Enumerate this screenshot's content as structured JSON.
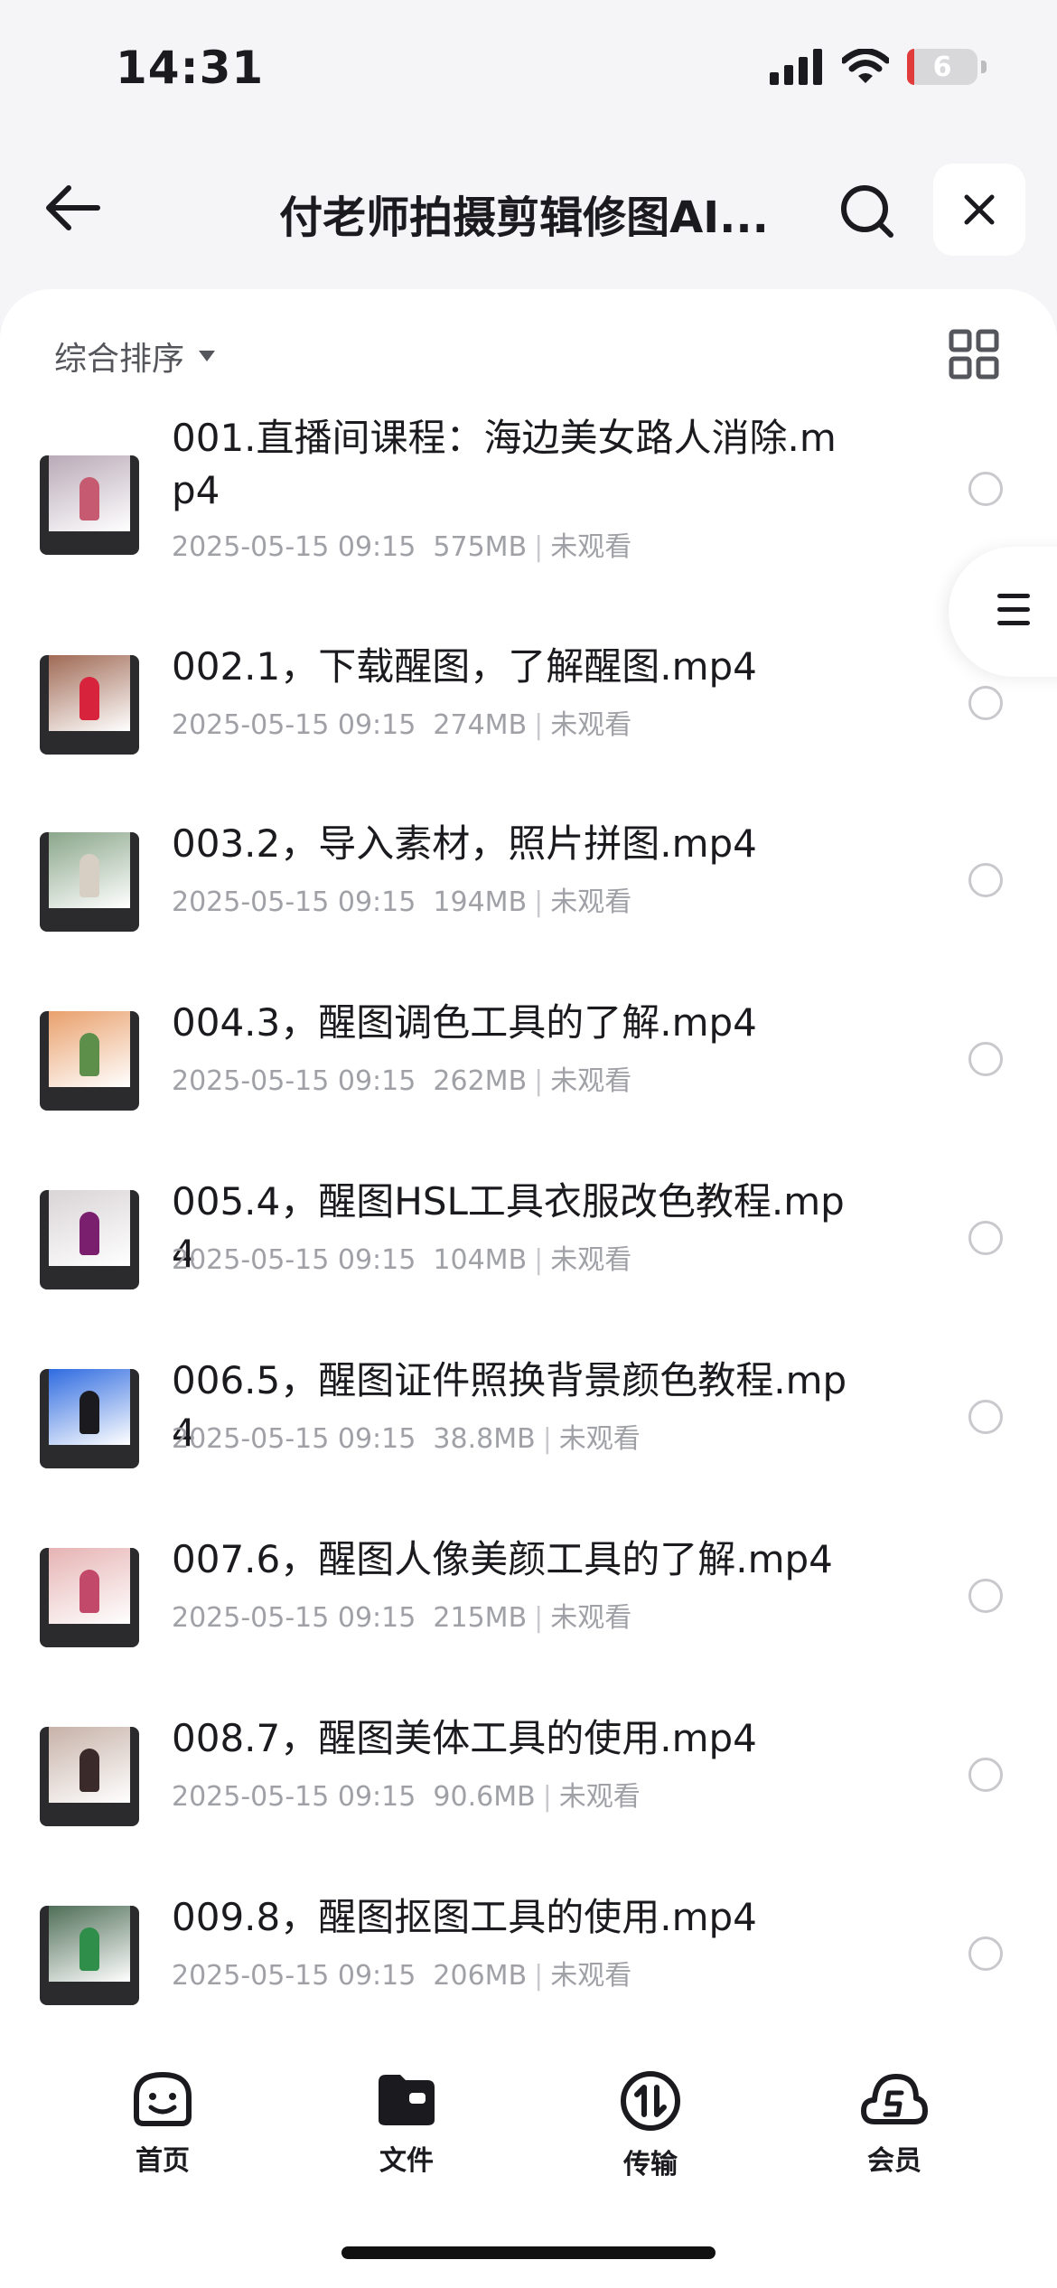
{
  "status_bar": {
    "time": "14:31",
    "battery": "6"
  },
  "nav": {
    "title": "付老师拍摄剪辑修图AI..."
  },
  "toolbar": {
    "sort_label": "综合排序"
  },
  "files": [
    {
      "name": "001.直播间课程：海边美女路人消除.mp4",
      "date": "2025-05-15 09:15",
      "size": "575MB",
      "status": "未观看",
      "thumb_bg": "#b9aab7",
      "thumb_person": "#c65a70"
    },
    {
      "name": "002.1，下载醒图，了解醒图.mp4",
      "date": "2025-05-15 09:15",
      "size": "274MB",
      "status": "未观看",
      "thumb_bg": "#a06a55",
      "thumb_person": "#d8233c"
    },
    {
      "name": "003.2，导入素材，照片拼图.mp4",
      "date": "2025-05-15 09:15",
      "size": "194MB",
      "status": "未观看",
      "thumb_bg": "#8aa68a",
      "thumb_person": "#d7cfc4"
    },
    {
      "name": "004.3，醒图调色工具的了解.mp4",
      "date": "2025-05-15 09:15",
      "size": "262MB",
      "status": "未观看",
      "thumb_bg": "#e9a06c",
      "thumb_person": "#5d8f4a"
    },
    {
      "name": "005.4，醒图HSL工具衣服改色教程.mp4",
      "date": "2025-05-15 09:15",
      "size": "104MB",
      "status": "未观看",
      "thumb_bg": "#d9d4d6",
      "thumb_person": "#7a1f6d"
    },
    {
      "name": "006.5，醒图证件照换背景颜色教程.mp4",
      "date": "2025-05-15 09:15",
      "size": "38.8MB",
      "status": "未观看",
      "thumb_bg": "#2f6be0",
      "thumb_person": "#1b1b1f"
    },
    {
      "name": "007.6，醒图人像美颜工具的了解.mp4",
      "date": "2025-05-15 09:15",
      "size": "215MB",
      "status": "未观看",
      "thumb_bg": "#e6b3b3",
      "thumb_person": "#c2496a"
    },
    {
      "name": "008.7，醒图美体工具的使用.mp4",
      "date": "2025-05-15 09:15",
      "size": "90.6MB",
      "status": "未观看",
      "thumb_bg": "#c7b2a8",
      "thumb_person": "#3a2a2a"
    },
    {
      "name": "009.8，醒图抠图工具的使用.mp4",
      "date": "2025-05-15 09:15",
      "size": "206MB",
      "status": "未观看",
      "thumb_bg": "#4f6e57",
      "thumb_person": "#2f8f4a"
    }
  ],
  "tabs": [
    {
      "label": "首页",
      "icon": "smiley-face-icon"
    },
    {
      "label": "文件",
      "icon": "folder-icon"
    },
    {
      "label": "传输",
      "icon": "transfer-icon"
    },
    {
      "label": "会员",
      "icon": "member-cloud-icon"
    }
  ]
}
